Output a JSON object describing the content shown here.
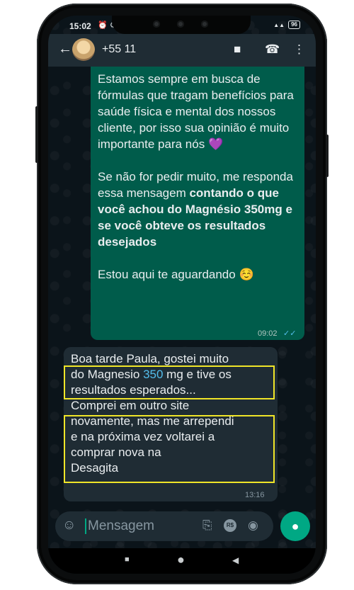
{
  "status_bar": {
    "time": "15:02",
    "icons_left": "⏰ ⚙ •",
    "signal": "▲▲",
    "battery": "96"
  },
  "header": {
    "contact_name": "+55 11",
    "back_icon": "←",
    "video_icon": "■",
    "call_icon": "☎",
    "menu_icon": "⋮"
  },
  "outgoing": {
    "paragraph1": "Estamos sempre em busca de fórmulas que tragam benefícios para saúde física e mental dos nossos cliente, por isso sua opinião é muito importante para nós",
    "heart": "💜",
    "paragraph2_start": "Se não for pedir muito, me responda essa mensagem ",
    "paragraph2_bold": "contando o que você achou do Magnésio 350mg e se você obteve os resultados desejados",
    "paragraph3": "Estou aqui te aguardando",
    "smile": "☺️",
    "time": "09:02",
    "ticks": "✓✓"
  },
  "incoming": {
    "line1": "Boa tarde Paula, gostei muito",
    "line2_pre": "do Magnesio ",
    "line2_num": "350",
    "line2_post": " mg e tive os",
    "line3": "resultados esperados...",
    "line4": "Comprei em outro site",
    "line5": "novamente, mas me arrependi",
    "line6": "e na próxima vez voltarei a",
    "line7": "comprar nova na",
    "line8": "Desagita",
    "time": "13:16"
  },
  "input": {
    "placeholder": "Mensagem",
    "emoji_icon": "☺",
    "attach_icon": "⎘",
    "rs_label": "R$",
    "camera_icon": "◉",
    "mic_icon": "●"
  },
  "nav": {
    "recents": "■",
    "home": "●",
    "back": "◀"
  },
  "colors": {
    "outgoing_bubble": "#005c4b",
    "incoming_bubble": "#1f2c34",
    "highlight": "#f0e528",
    "accent": "#00a884"
  }
}
